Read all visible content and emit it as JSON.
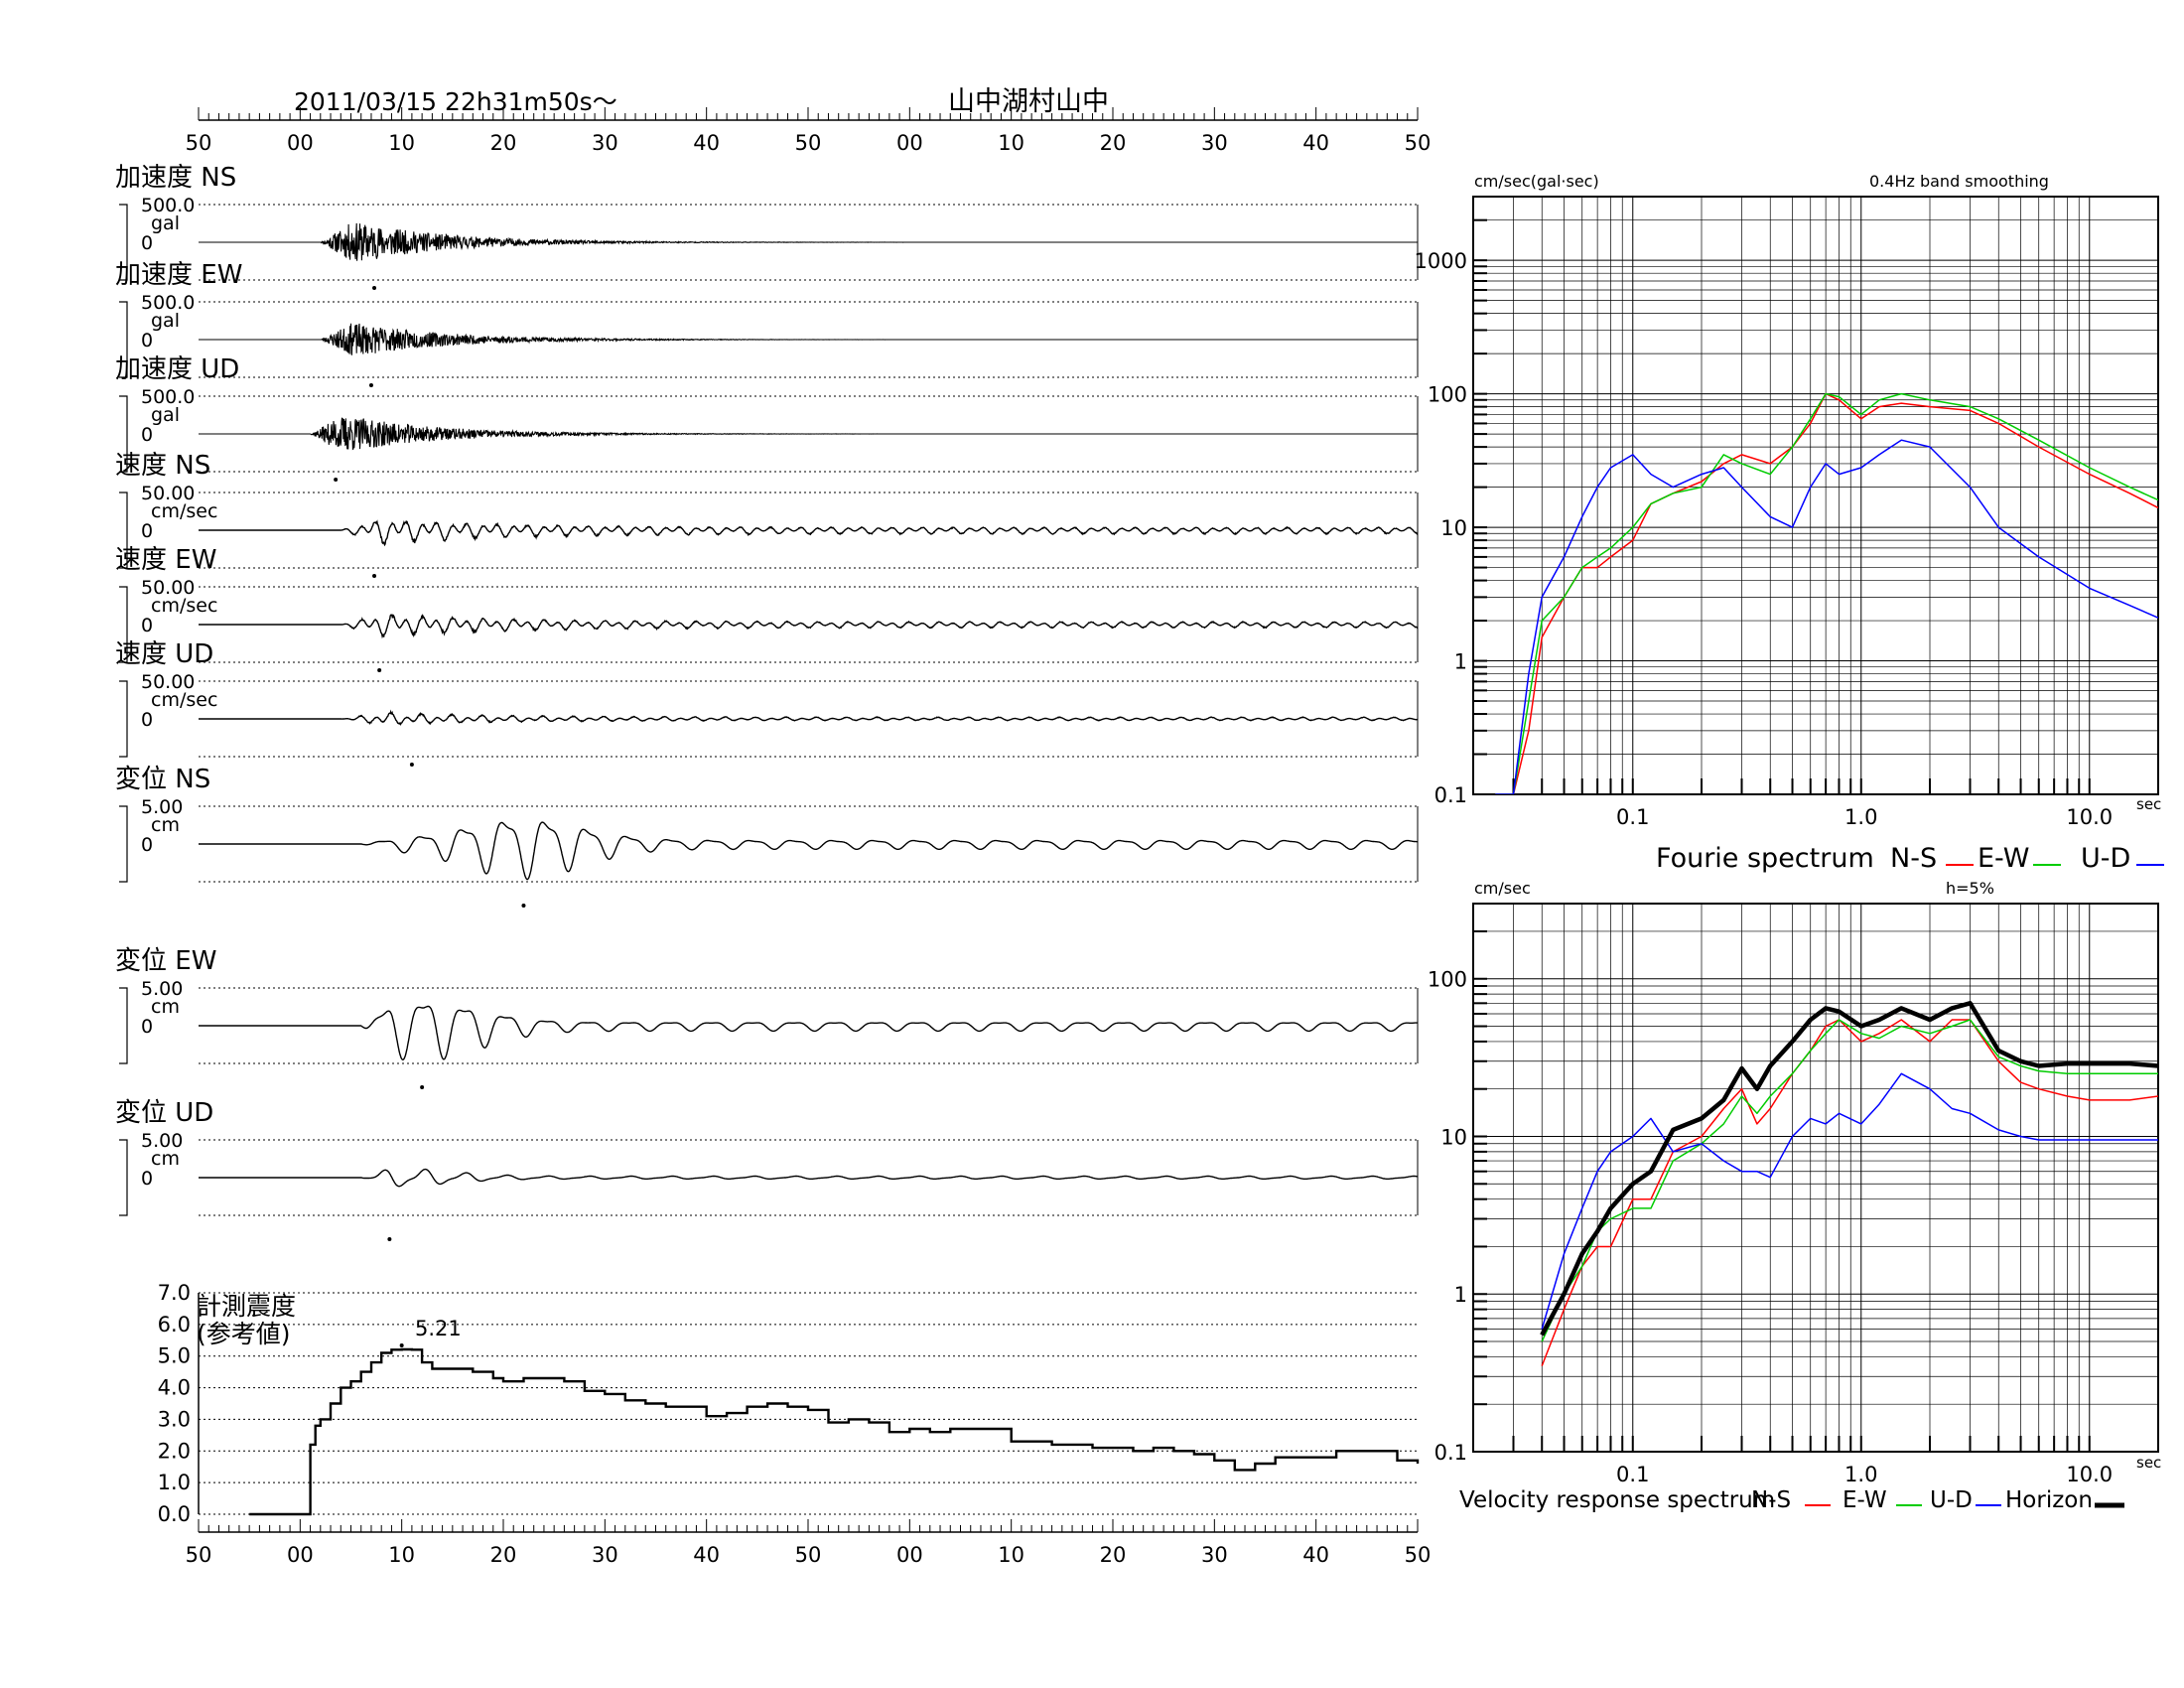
{
  "header": {
    "datetime": "2011/03/15  22h31m50s～",
    "station": "山中湖村山中"
  },
  "time_axis": {
    "tick_labels": [
      "50",
      "00",
      "10",
      "20",
      "30",
      "40",
      "50",
      "00",
      "10",
      "20",
      "30",
      "40",
      "50"
    ]
  },
  "traces": [
    {
      "label": "加速度 NS",
      "scale": "500.0",
      "unit": "gal",
      "zero": "0",
      "kind": "acc",
      "seed": 11,
      "amp": 0.55,
      "t0": 6,
      "peak": 7.3
    },
    {
      "label": "加速度 EW",
      "scale": "500.0",
      "unit": "gal",
      "zero": "0",
      "kind": "acc",
      "seed": 23,
      "amp": 0.45,
      "t0": 6,
      "peak": 7.0
    },
    {
      "label": "加速度 UD",
      "scale": "500.0",
      "unit": "gal",
      "zero": "0",
      "kind": "acc",
      "seed": 37,
      "amp": 0.5,
      "t0": 5,
      "peak": 3.5
    },
    {
      "label": "速度 NS",
      "scale": "50.00",
      "unit": "cm/sec",
      "zero": "0",
      "kind": "vel",
      "seed": 41,
      "amp": 0.45,
      "t0": 8,
      "peak": 7.3
    },
    {
      "label": "速度 EW",
      "scale": "50.00",
      "unit": "cm/sec",
      "zero": "0",
      "kind": "vel",
      "seed": 53,
      "amp": 0.4,
      "t0": 8,
      "peak": 7.8
    },
    {
      "label": "速度 UD",
      "scale": "50.00",
      "unit": "cm/sec",
      "zero": "0",
      "kind": "vel",
      "seed": 67,
      "amp": 0.22,
      "t0": 8,
      "peak": 11.0
    },
    {
      "label": "変位 NS",
      "scale": "5.00",
      "unit": "cm",
      "zero": "0",
      "kind": "disp",
      "seed": 71,
      "amp": 1.0,
      "t0": 10,
      "peak": 22.0
    },
    {
      "label": "変位 EW",
      "scale": "5.00",
      "unit": "cm",
      "zero": "0",
      "kind": "disp",
      "seed": 83,
      "amp": 1.0,
      "t0": 10,
      "peak": 12.0
    },
    {
      "label": "変位 UD",
      "scale": "5.00",
      "unit": "cm",
      "zero": "0",
      "kind": "disp",
      "seed": 97,
      "amp": 0.3,
      "t0": 10,
      "peak": 8.8
    }
  ],
  "intensity": {
    "title_line1": "計測震度",
    "title_line2": "(参考値)",
    "max_label": "5.21",
    "y_ticks": [
      "7.0",
      "6.0",
      "5.0",
      "4.0",
      "3.0",
      "2.0",
      "1.0",
      "0.0"
    ]
  },
  "fourier": {
    "y_unit": "cm/sec(gal·sec)",
    "note": "0.4Hz band smoothing",
    "x_unit": "sec",
    "y_tick_labels": [
      "1000",
      "100",
      "10",
      "1",
      "0.1"
    ],
    "x_tick_labels": [
      "0.1",
      "1.0",
      "10.0"
    ],
    "legend_title": "Fourie spectrum",
    "legend": [
      "N-S",
      "E-W",
      "U-D"
    ]
  },
  "response": {
    "y_unit": "cm/sec",
    "note": "h=5%",
    "x_unit": "sec",
    "y_tick_labels": [
      "100",
      "10",
      "1",
      "0.1"
    ],
    "x_tick_labels": [
      "0.1",
      "1.0",
      "10.0"
    ],
    "legend_title": "Velocity response spectrum",
    "legend": [
      "N-S",
      "E-W",
      "U-D",
      "Horizon"
    ]
  },
  "colors": {
    "ns": "#ff0000",
    "ew": "#00cc00",
    "ud": "#0000ff",
    "horizon": "#000000"
  },
  "chart_data": [
    {
      "type": "line",
      "title": "計測震度 (参考値)",
      "x": [
        -5,
        -1,
        0.5,
        1,
        1.5,
        2,
        3,
        4,
        5,
        6,
        7,
        8,
        9,
        10,
        11,
        12,
        13,
        15,
        17,
        19,
        20,
        22,
        24,
        26,
        28,
        30,
        32,
        34,
        36,
        38,
        40,
        42,
        44,
        46,
        48,
        50,
        52,
        54,
        56,
        58,
        60,
        62,
        64,
        66,
        68,
        70,
        72,
        74,
        76,
        78,
        80,
        82,
        84,
        86,
        88,
        90,
        92,
        94,
        96,
        98,
        100,
        102,
        104,
        106,
        108,
        110
      ],
      "values": [
        0,
        0,
        0,
        2.2,
        2.8,
        3.0,
        3.5,
        4.0,
        4.2,
        4.5,
        4.8,
        5.1,
        5.2,
        5.21,
        5.2,
        4.8,
        4.6,
        4.6,
        4.5,
        4.3,
        4.2,
        4.3,
        4.3,
        4.2,
        3.9,
        3.8,
        3.6,
        3.5,
        3.4,
        3.4,
        3.1,
        3.2,
        3.4,
        3.5,
        3.4,
        3.3,
        2.9,
        3.0,
        2.9,
        2.6,
        2.7,
        2.6,
        2.7,
        2.7,
        2.7,
        2.3,
        2.3,
        2.2,
        2.2,
        2.1,
        2.1,
        2.0,
        2.1,
        2.0,
        1.9,
        1.7,
        1.4,
        1.6,
        1.8,
        1.8,
        1.8,
        2.0,
        2.0,
        2.0,
        1.7,
        1.6
      ],
      "ylim": [
        0,
        7
      ],
      "max_value": 5.21,
      "max_time": 10
    },
    {
      "type": "line",
      "title": "Fourie spectrum",
      "x_scale": "log",
      "y_scale": "log",
      "xlim": [
        0.02,
        20
      ],
      "ylim": [
        0.1,
        3000
      ],
      "x": [
        0.025,
        0.03,
        0.035,
        0.04,
        0.05,
        0.06,
        0.07,
        0.08,
        0.1,
        0.12,
        0.15,
        0.2,
        0.25,
        0.3,
        0.4,
        0.5,
        0.6,
        0.7,
        0.8,
        1.0,
        1.2,
        1.5,
        2.0,
        3.0,
        4.0,
        6.0,
        10.0,
        15.0,
        20.0
      ],
      "series": [
        {
          "name": "N-S",
          "values": [
            0.1,
            0.1,
            0.3,
            1.5,
            3,
            5,
            5,
            6,
            8,
            15,
            18,
            22,
            30,
            35,
            30,
            40,
            60,
            100,
            90,
            65,
            80,
            85,
            80,
            75,
            60,
            40,
            25,
            18,
            14
          ]
        },
        {
          "name": "E-W",
          "values": [
            0.1,
            0.1,
            0.5,
            2,
            3,
            5,
            6,
            7,
            10,
            15,
            18,
            20,
            35,
            30,
            25,
            40,
            65,
            100,
            95,
            70,
            90,
            100,
            90,
            80,
            65,
            45,
            28,
            20,
            16
          ]
        },
        {
          "name": "U-D",
          "values": [
            0.1,
            0.1,
            0.8,
            3,
            6,
            12,
            20,
            28,
            35,
            25,
            20,
            25,
            28,
            20,
            12,
            10,
            20,
            30,
            25,
            28,
            35,
            45,
            40,
            20,
            10,
            6,
            3.5,
            2.6,
            2.1
          ]
        }
      ]
    },
    {
      "type": "line",
      "title": "Velocity response spectrum",
      "x_scale": "log",
      "y_scale": "log",
      "xlim": [
        0.02,
        20
      ],
      "ylim": [
        0.1,
        300
      ],
      "x": [
        0.04,
        0.05,
        0.06,
        0.07,
        0.08,
        0.1,
        0.12,
        0.15,
        0.2,
        0.25,
        0.3,
        0.35,
        0.4,
        0.5,
        0.6,
        0.7,
        0.8,
        1.0,
        1.2,
        1.5,
        2.0,
        2.5,
        3.0,
        4.0,
        5.0,
        6.0,
        8.0,
        10.0,
        15.0,
        20.0
      ],
      "series": [
        {
          "name": "N-S",
          "values": [
            0.35,
            0.8,
            1.5,
            2,
            2,
            4,
            4,
            8,
            10,
            15,
            20,
            12,
            15,
            25,
            35,
            50,
            55,
            40,
            45,
            55,
            40,
            55,
            55,
            30,
            22,
            20,
            18,
            17,
            17,
            18
          ]
        },
        {
          "name": "E-W",
          "values": [
            0.5,
            1.0,
            1.5,
            2.5,
            3.0,
            3.5,
            3.5,
            7,
            9,
            12,
            18,
            14,
            18,
            25,
            35,
            45,
            55,
            45,
            42,
            50,
            45,
            50,
            55,
            32,
            28,
            26,
            25,
            25,
            25,
            25
          ]
        },
        {
          "name": "U-D",
          "values": [
            0.6,
            1.8,
            3.5,
            6,
            8,
            10,
            13,
            8,
            9,
            7,
            6,
            6,
            5.5,
            10,
            13,
            12,
            14,
            12,
            16,
            25,
            20,
            15,
            14,
            11,
            10,
            9.5,
            9.5,
            9.5,
            9.5,
            9.5
          ]
        },
        {
          "name": "Horizon",
          "values": [
            0.55,
            1.0,
            1.8,
            2.5,
            3.5,
            5,
            6,
            11,
            13,
            17,
            27,
            20,
            28,
            40,
            55,
            65,
            62,
            50,
            55,
            65,
            55,
            65,
            70,
            35,
            30,
            28,
            29,
            29,
            29,
            28
          ]
        }
      ]
    }
  ]
}
